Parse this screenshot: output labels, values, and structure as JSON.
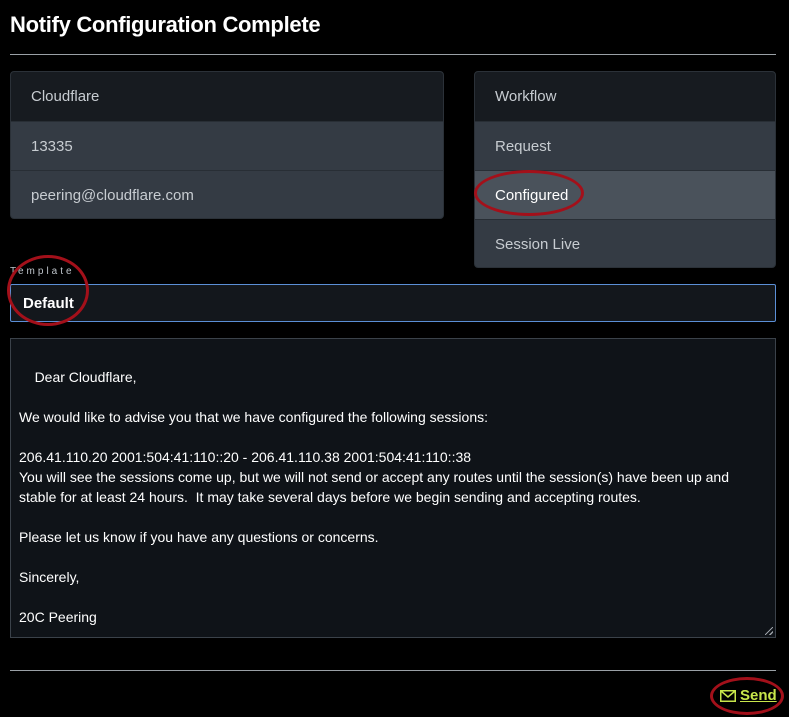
{
  "page": {
    "title": "Notify Configuration Complete"
  },
  "network_panel": {
    "name": "Cloudflare",
    "asn": "13335",
    "email": "peering@cloudflare.com"
  },
  "workflow_panel": {
    "header": "Workflow",
    "steps": [
      "Request",
      "Configured",
      "Session Live"
    ],
    "active_step": "Configured"
  },
  "template": {
    "label": "Template",
    "selected": "Default"
  },
  "message": {
    "body": "Dear Cloudflare,\n\nWe would like to advise you that we have configured the following sessions:\n\n206.41.110.20 2001:504:41:110::20 - 206.41.110.38 2001:504:41:110::38\nYou will see the sessions come up, but we will not send or accept any routes until the session(s) have been up and stable for at least 24 hours.  It may take several days before we begin sending and accepting routes.\n\nPlease let us know if you have any questions or concerns.\n\nSincerely,\n\n20C Peering"
  },
  "actions": {
    "send_label": "Send",
    "send_icon": "envelope-icon"
  },
  "colors": {
    "background": "#000000",
    "panel": "#343b44",
    "panel_header": "#171b20",
    "active_row": "#4a525b",
    "select_border": "#5b8fd6",
    "link": "#c8e64b",
    "annotation": "#a3101a"
  }
}
